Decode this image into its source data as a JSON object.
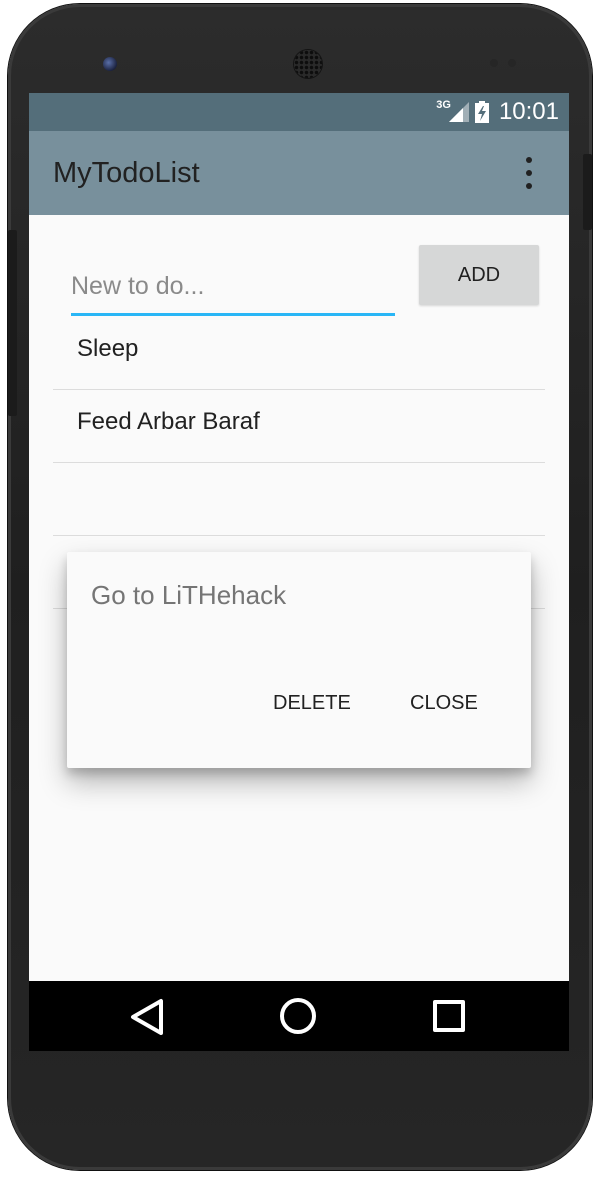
{
  "status_bar": {
    "network": "3G",
    "time": "10:01"
  },
  "app_bar": {
    "title": "MyTodoList"
  },
  "input": {
    "placeholder": "New to do...",
    "value": ""
  },
  "add_button": {
    "label": "ADD"
  },
  "todo_items": [
    {
      "label": "Sleep"
    },
    {
      "label": "Feed Arbar Baraf"
    },
    {
      "label": ""
    },
    {
      "label": ""
    },
    {
      "label": ""
    }
  ],
  "dialog": {
    "title": "Go to LiTHehack",
    "delete_label": "DELETE",
    "close_label": "CLOSE"
  },
  "colors": {
    "status_bar": "#546e7a",
    "app_bar": "#78909c",
    "accent": "#29b6f6",
    "background": "#fafafa"
  },
  "icons": {
    "overflow": "overflow-menu-icon",
    "back": "back-icon",
    "home": "home-icon",
    "recents": "recents-icon",
    "signal": "signal-icon",
    "battery": "battery-charging-icon"
  }
}
